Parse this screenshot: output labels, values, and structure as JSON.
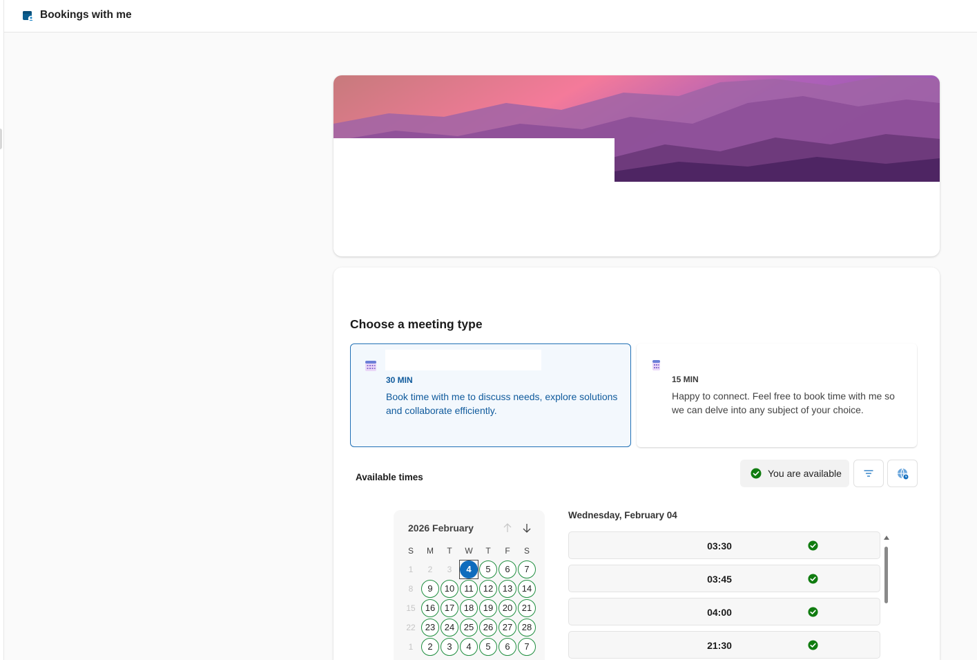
{
  "app": {
    "title": "Bookings with me",
    "icon": "bookings-app-icon"
  },
  "meeting_types": {
    "heading": "Choose a meeting type",
    "items": [
      {
        "duration": "30 MIN",
        "description": "Book time with me to discuss needs, explore solutions and collaborate efficiently.",
        "selected": true,
        "icon": "calendar-icon"
      },
      {
        "duration": "15 MIN",
        "description": "Happy to connect. Feel free to book time with me so we can delve into any subject of your choice.",
        "selected": false,
        "icon": "calendar-icon"
      }
    ]
  },
  "availability": {
    "label": "Available times",
    "status": "You are available",
    "status_icon": "check-circle-icon",
    "filter_icon": "filter-icon",
    "timezone_icon": "globe-icon"
  },
  "calendar": {
    "title": "2026 February",
    "weekdays": [
      "S",
      "M",
      "T",
      "W",
      "T",
      "F",
      "S"
    ],
    "weeks": [
      [
        {
          "d": "1",
          "s": "muted"
        },
        {
          "d": "2",
          "s": "muted"
        },
        {
          "d": "3",
          "s": "muted"
        },
        {
          "d": "4",
          "s": "selected"
        },
        {
          "d": "5",
          "s": "avail"
        },
        {
          "d": "6",
          "s": "avail"
        },
        {
          "d": "7",
          "s": "avail"
        }
      ],
      [
        {
          "d": "8",
          "s": "muted"
        },
        {
          "d": "9",
          "s": "avail"
        },
        {
          "d": "10",
          "s": "avail"
        },
        {
          "d": "11",
          "s": "avail"
        },
        {
          "d": "12",
          "s": "avail"
        },
        {
          "d": "13",
          "s": "avail"
        },
        {
          "d": "14",
          "s": "avail"
        }
      ],
      [
        {
          "d": "15",
          "s": "muted"
        },
        {
          "d": "16",
          "s": "avail"
        },
        {
          "d": "17",
          "s": "avail"
        },
        {
          "d": "18",
          "s": "avail"
        },
        {
          "d": "19",
          "s": "avail"
        },
        {
          "d": "20",
          "s": "avail"
        },
        {
          "d": "21",
          "s": "avail"
        }
      ],
      [
        {
          "d": "22",
          "s": "muted"
        },
        {
          "d": "23",
          "s": "avail"
        },
        {
          "d": "24",
          "s": "avail"
        },
        {
          "d": "25",
          "s": "avail"
        },
        {
          "d": "26",
          "s": "avail"
        },
        {
          "d": "27",
          "s": "avail"
        },
        {
          "d": "28",
          "s": "avail"
        }
      ],
      [
        {
          "d": "1",
          "s": "muted"
        },
        {
          "d": "2",
          "s": "avail"
        },
        {
          "d": "3",
          "s": "avail"
        },
        {
          "d": "4",
          "s": "avail"
        },
        {
          "d": "5",
          "s": "avail"
        },
        {
          "d": "6",
          "s": "avail"
        },
        {
          "d": "7",
          "s": "avail"
        }
      ]
    ]
  },
  "slots": {
    "date_heading": "Wednesday, February 04",
    "times": [
      "03:30",
      "03:45",
      "04:00",
      "21:30"
    ]
  },
  "colors": {
    "accent": "#0f6cbd",
    "available_green": "#1e8e3e",
    "selected_card_border": "#1f6fb5"
  }
}
